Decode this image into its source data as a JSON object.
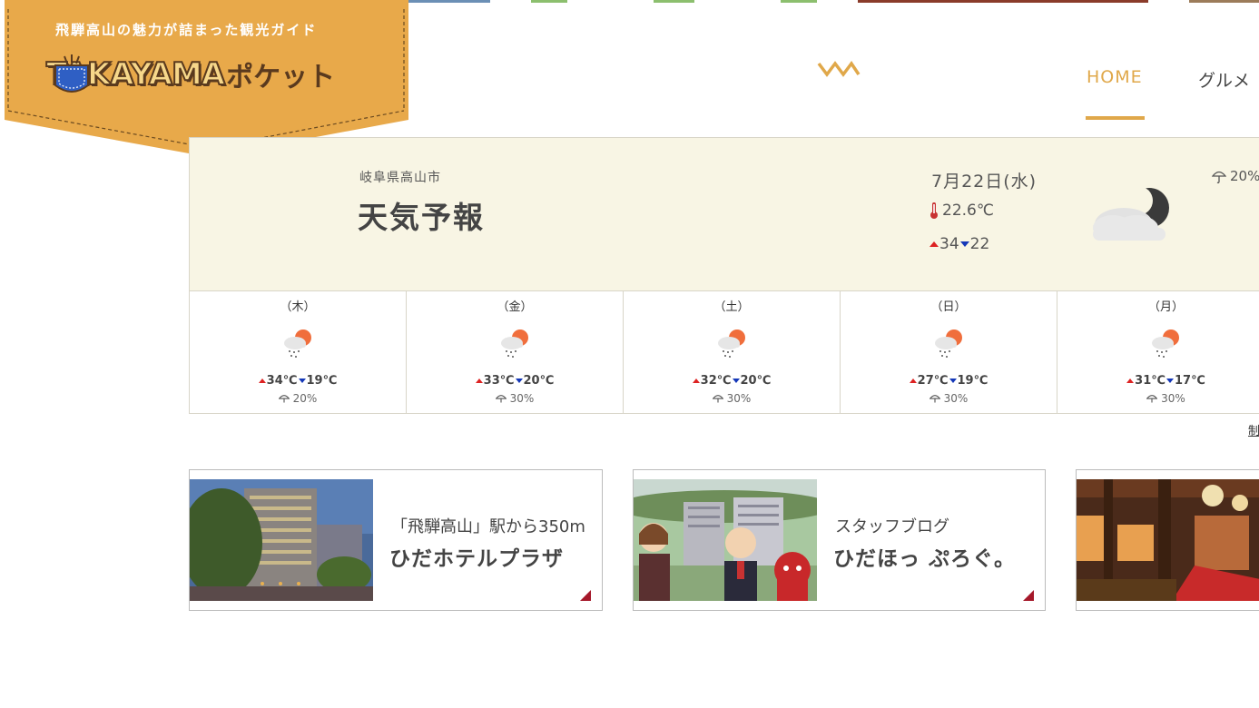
{
  "site": {
    "tagline": "飛騨高山の魅力が詰まった観光ガイド",
    "logo_word": "TAKAYAMA",
    "logo_kana": "ポケット",
    "brand_color": "#e8a94a"
  },
  "nav": {
    "home": "HOME",
    "gourmet": "グルメ",
    "active_color": "#e0a84a"
  },
  "weather": {
    "prefecture": "岐阜県高山市",
    "title": "天気予報",
    "date": "7月22日(水)",
    "current_temp": "22.6℃",
    "high": "34",
    "low": "22",
    "rain": "20%",
    "icon": "cloud-moon-icon",
    "forecast": [
      {
        "day": "（木）",
        "high": "34℃",
        "low": "19℃",
        "rain": "20%",
        "icon": "rain-sun-icon"
      },
      {
        "day": "（金）",
        "high": "33℃",
        "low": "20℃",
        "rain": "30%",
        "icon": "rain-sun-icon"
      },
      {
        "day": "（土）",
        "high": "32℃",
        "low": "20℃",
        "rain": "30%",
        "icon": "rain-sun-icon"
      },
      {
        "day": "（日）",
        "high": "27℃",
        "low": "19℃",
        "rain": "30%",
        "icon": "rain-sun-icon"
      },
      {
        "day": "（月）",
        "high": "31℃",
        "low": "17℃",
        "rain": "30%",
        "icon": "rain-sun-icon"
      }
    ],
    "source_link": "制"
  },
  "banners": [
    {
      "subtitle": "「飛騨高山」駅から350m",
      "title": "ひだホテルプラザ"
    },
    {
      "subtitle": "スタッフブログ",
      "title": "ひだほっ ぷろぐ。"
    },
    {
      "subtitle": "",
      "title": ""
    }
  ]
}
